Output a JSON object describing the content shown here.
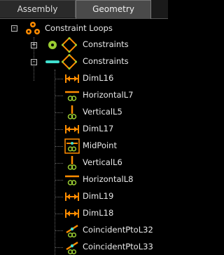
{
  "tabs": [
    {
      "label": "Assembly",
      "active": false
    },
    {
      "label": "Geometry",
      "active": true
    }
  ],
  "tree": {
    "root": {
      "label": "Constraint Loops",
      "icon": "constraint-loops-icon",
      "expander": "-"
    },
    "groups": [
      {
        "label": "Constraints",
        "icon": "constraints-icon",
        "status_icon": "point-status-icon",
        "expander": "+"
      },
      {
        "label": "Constraints",
        "icon": "constraints-icon",
        "status_icon": "line-status-icon",
        "expander": "-"
      }
    ],
    "items": [
      {
        "label": "DimL16",
        "icon": "dimension-icon"
      },
      {
        "label": "HorizontalL7",
        "icon": "horizontal-constraint-icon"
      },
      {
        "label": "VerticalL5",
        "icon": "vertical-constraint-icon"
      },
      {
        "label": "DimL17",
        "icon": "dimension-icon"
      },
      {
        "label": "MidPoint",
        "icon": "midpoint-icon"
      },
      {
        "label": "VerticalL6",
        "icon": "vertical-constraint-icon"
      },
      {
        "label": "HorizontalL8",
        "icon": "horizontal-constraint-icon"
      },
      {
        "label": "DimL19",
        "icon": "dimension-icon"
      },
      {
        "label": "DimL18",
        "icon": "dimension-icon"
      },
      {
        "label": "CoincidentPtoL32",
        "icon": "coincident-constraint-icon"
      },
      {
        "label": "CoincidentPtoL33",
        "icon": "coincident-constraint-icon"
      }
    ]
  },
  "colors": {
    "accent": "#ff8c00",
    "status_green": "#9acd32",
    "status_cyan": "#40e0d0"
  }
}
